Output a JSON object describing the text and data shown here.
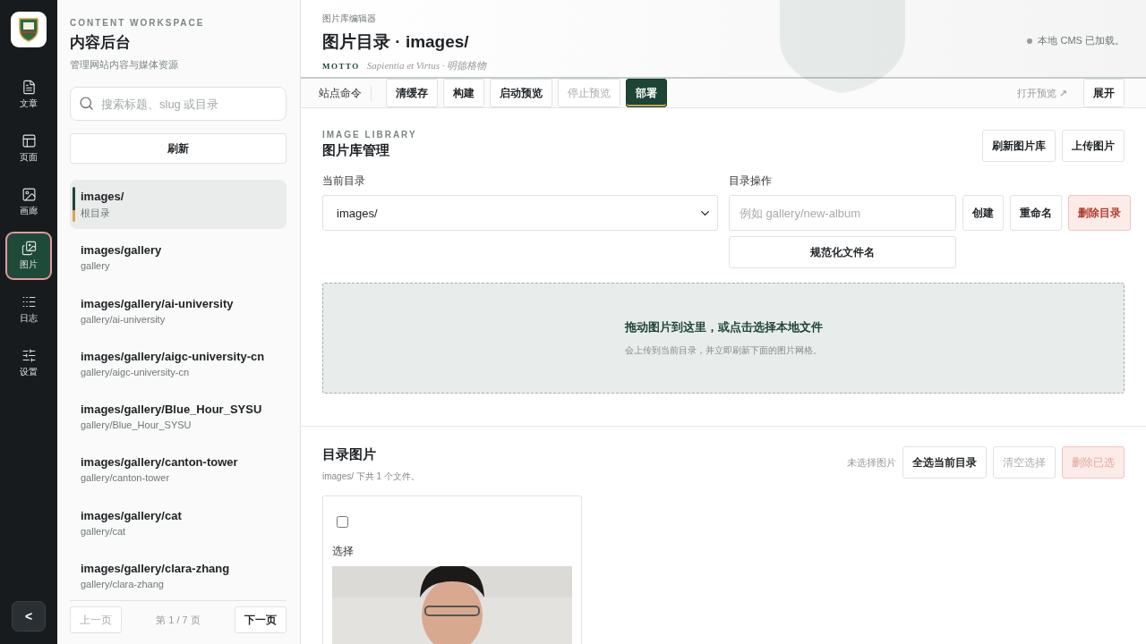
{
  "rail": {
    "items": [
      {
        "label": "文章",
        "selected": false
      },
      {
        "label": "页面",
        "selected": false
      },
      {
        "label": "画廊",
        "selected": false
      },
      {
        "label": "图片",
        "selected": true
      },
      {
        "label": "日志",
        "selected": false
      },
      {
        "label": "设置",
        "selected": false
      }
    ],
    "collapse": "<"
  },
  "sidebar": {
    "eyebrow": "CONTENT WORKSPACE",
    "title": "内容后台",
    "subtitle": "管理网站内容与媒体资源",
    "search": {
      "placeholder": "搜索标题、slug 或目录"
    },
    "refresh": "刷新",
    "dirs": [
      {
        "path": "images/",
        "name": "根目录",
        "selected": true
      },
      {
        "path": "images/gallery",
        "name": "gallery",
        "selected": false
      },
      {
        "path": "images/gallery/ai-university",
        "name": "gallery/ai-university",
        "selected": false
      },
      {
        "path": "images/gallery/aigc-university-cn",
        "name": "gallery/aigc-university-cn",
        "selected": false
      },
      {
        "path": "images/gallery/Blue_Hour_SYSU",
        "name": "gallery/Blue_Hour_SYSU",
        "selected": false
      },
      {
        "path": "images/gallery/canton-tower",
        "name": "gallery/canton-tower",
        "selected": false
      },
      {
        "path": "images/gallery/cat",
        "name": "gallery/cat",
        "selected": false
      },
      {
        "path": "images/gallery/clara-zhang",
        "name": "gallery/clara-zhang",
        "selected": false
      }
    ],
    "pager": {
      "prev": {
        "label": "上一页",
        "disabled": true
      },
      "page": "第 1 / 7 页",
      "next": {
        "label": "下一页",
        "disabled": false
      }
    }
  },
  "header": {
    "breadcrumb": "图片库编辑器",
    "title": "图片目录 · images/",
    "motto_label": "MOTTO",
    "motto": "Sapientia et Virtus · 明德格物",
    "status": "本地 CMS 已加载。"
  },
  "commands": {
    "label": "站点命令",
    "buttons": [
      {
        "label": "清缓存",
        "disabled": false,
        "selected": false
      },
      {
        "label": "构建",
        "disabled": false,
        "selected": false
      },
      {
        "label": "启动预览",
        "disabled": false,
        "selected": false
      },
      {
        "label": "停止预览",
        "disabled": true,
        "selected": false
      },
      {
        "label": "部署",
        "disabled": false,
        "selected": true
      }
    ],
    "open_preview": "打开预览 ↗",
    "expand": "展开"
  },
  "library": {
    "eyebrow": "IMAGE LIBRARY",
    "title": "图片库管理",
    "actions": [
      "刷新图片库",
      "上传图片"
    ],
    "current_dir": {
      "label": "当前目录",
      "value": "images/"
    },
    "dir_ops": {
      "label": "目录操作",
      "placeholder": "例如 gallery/new-album",
      "buttons": [
        {
          "label": "创建",
          "kind": "normal"
        },
        {
          "label": "重命名",
          "kind": "normal"
        },
        {
          "label": "删除目录",
          "kind": "danger"
        }
      ],
      "normalize": "规范化文件名"
    },
    "dropzone": {
      "title": "拖动图片到这里，或点击选择本地文件",
      "hint": "会上传到当前目录，并立即刷新下面的图片网格。"
    }
  },
  "gallery": {
    "title": "目录图片",
    "summary": "images/ 下共 1 个文件。",
    "selection": "未选择图片",
    "buttons": [
      {
        "label": "全选当前目录",
        "disabled": false,
        "kind": "normal"
      },
      {
        "label": "清空选择",
        "disabled": true,
        "kind": "normal"
      },
      {
        "label": "删除已选",
        "disabled": true,
        "kind": "danger"
      }
    ],
    "cards": [
      {
        "checked": false,
        "select_label": "选择",
        "kind": "picture"
      }
    ]
  }
}
